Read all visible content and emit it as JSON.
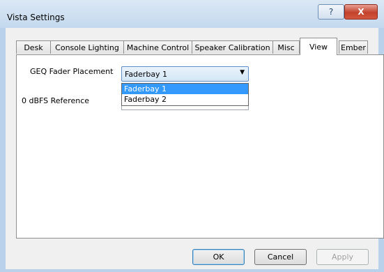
{
  "window": {
    "title": "Vista Settings"
  },
  "titlebar_buttons": {
    "help": "?",
    "close": "X"
  },
  "tabs": [
    {
      "label": "Desk"
    },
    {
      "label": "Console Lighting"
    },
    {
      "label": "Machine Control"
    },
    {
      "label": "Speaker Calibration"
    },
    {
      "label": "Misc"
    },
    {
      "label": "View",
      "active": true
    },
    {
      "label": "Ember"
    }
  ],
  "view": {
    "geq_label": "GEQ Fader Placement",
    "geq_value": "Faderbay 1",
    "geq_options": [
      "Faderbay 1",
      "Faderbay 2"
    ],
    "dbfs_label": "0 dBFS Reference"
  },
  "buttons": {
    "ok": "OK",
    "cancel": "Cancel",
    "apply": "Apply"
  }
}
